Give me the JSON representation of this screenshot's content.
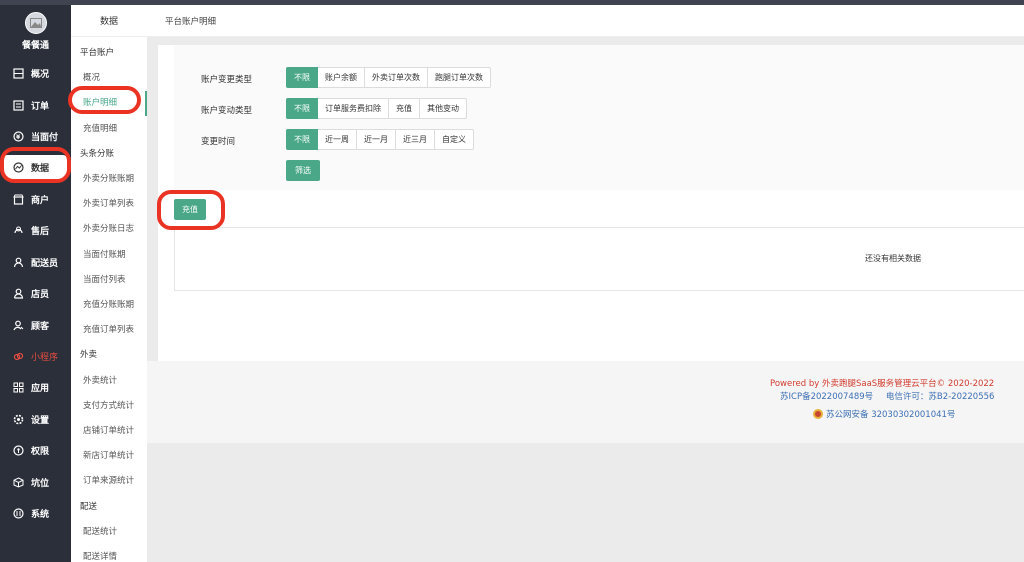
{
  "nav": {
    "brand": "餐餐通",
    "items": [
      {
        "label": "概况",
        "icon": "home-icon"
      },
      {
        "label": "订单",
        "icon": "list-icon"
      },
      {
        "label": "当面付",
        "icon": "yen-icon"
      },
      {
        "label": "数据",
        "icon": "chart-icon"
      },
      {
        "label": "商户",
        "icon": "store-icon"
      },
      {
        "label": "售后",
        "icon": "service-icon"
      },
      {
        "label": "配送员",
        "icon": "courier-icon"
      },
      {
        "label": "店员",
        "icon": "staff-icon"
      },
      {
        "label": "顾客",
        "icon": "customer-icon"
      },
      {
        "label": "小程序",
        "icon": "miniapp-icon"
      },
      {
        "label": "应用",
        "icon": "apps-icon"
      },
      {
        "label": "设置",
        "icon": "gear-icon"
      },
      {
        "label": "权限",
        "icon": "shield-icon"
      },
      {
        "label": "坑位",
        "icon": "cube-icon"
      },
      {
        "label": "系统",
        "icon": "system-icon"
      }
    ]
  },
  "submenu": {
    "title": "数据",
    "items": [
      {
        "label": "平台账户",
        "type": "group"
      },
      {
        "label": "概况",
        "type": "item"
      },
      {
        "label": "账户明细",
        "type": "item"
      },
      {
        "label": "充值明细",
        "type": "item"
      },
      {
        "label": "头条分账",
        "type": "group"
      },
      {
        "label": "外卖分账账期",
        "type": "item"
      },
      {
        "label": "外卖订单列表",
        "type": "item"
      },
      {
        "label": "外卖分账日志",
        "type": "item"
      },
      {
        "label": "当面付账期",
        "type": "item"
      },
      {
        "label": "当面付列表",
        "type": "item"
      },
      {
        "label": "充值分账账期",
        "type": "item"
      },
      {
        "label": "充值订单列表",
        "type": "item"
      },
      {
        "label": "外卖",
        "type": "group"
      },
      {
        "label": "外卖统计",
        "type": "item"
      },
      {
        "label": "支付方式统计",
        "type": "item"
      },
      {
        "label": "店铺订单统计",
        "type": "item"
      },
      {
        "label": "新店订单统计",
        "type": "item"
      },
      {
        "label": "订单来源统计",
        "type": "item"
      },
      {
        "label": "配送",
        "type": "group"
      },
      {
        "label": "配送统计",
        "type": "item"
      },
      {
        "label": "配送详情",
        "type": "item"
      }
    ]
  },
  "header": {
    "title": "平台账户明细"
  },
  "filters": {
    "change_type": {
      "label": "账户变更类型",
      "options": [
        "不限",
        "账户余额",
        "外卖订单次数",
        "跑腿订单次数"
      ]
    },
    "move_type": {
      "label": "账户变动类型",
      "options": [
        "不限",
        "订单服务费扣除",
        "充值",
        "其他变动"
      ]
    },
    "time": {
      "label": "变更时间",
      "options": [
        "不限",
        "近一周",
        "近一月",
        "近三月",
        "自定义"
      ]
    },
    "filter_button": "筛选"
  },
  "recharge_button": "充值",
  "table": {
    "empty_text": "还没有相关数据"
  },
  "footer": {
    "powered": "Powered by 外卖跑腿SaaS服务管理云平台© 2020-2022",
    "icp": "苏ICP备2022007489号",
    "telecom": "电信许可：苏B2-20220556",
    "police": "苏公网安备 32030302001041号"
  },
  "colors": {
    "accent": "#4aa889",
    "nav_bg": "#2b2f3a",
    "annotation": "#ea3323"
  }
}
